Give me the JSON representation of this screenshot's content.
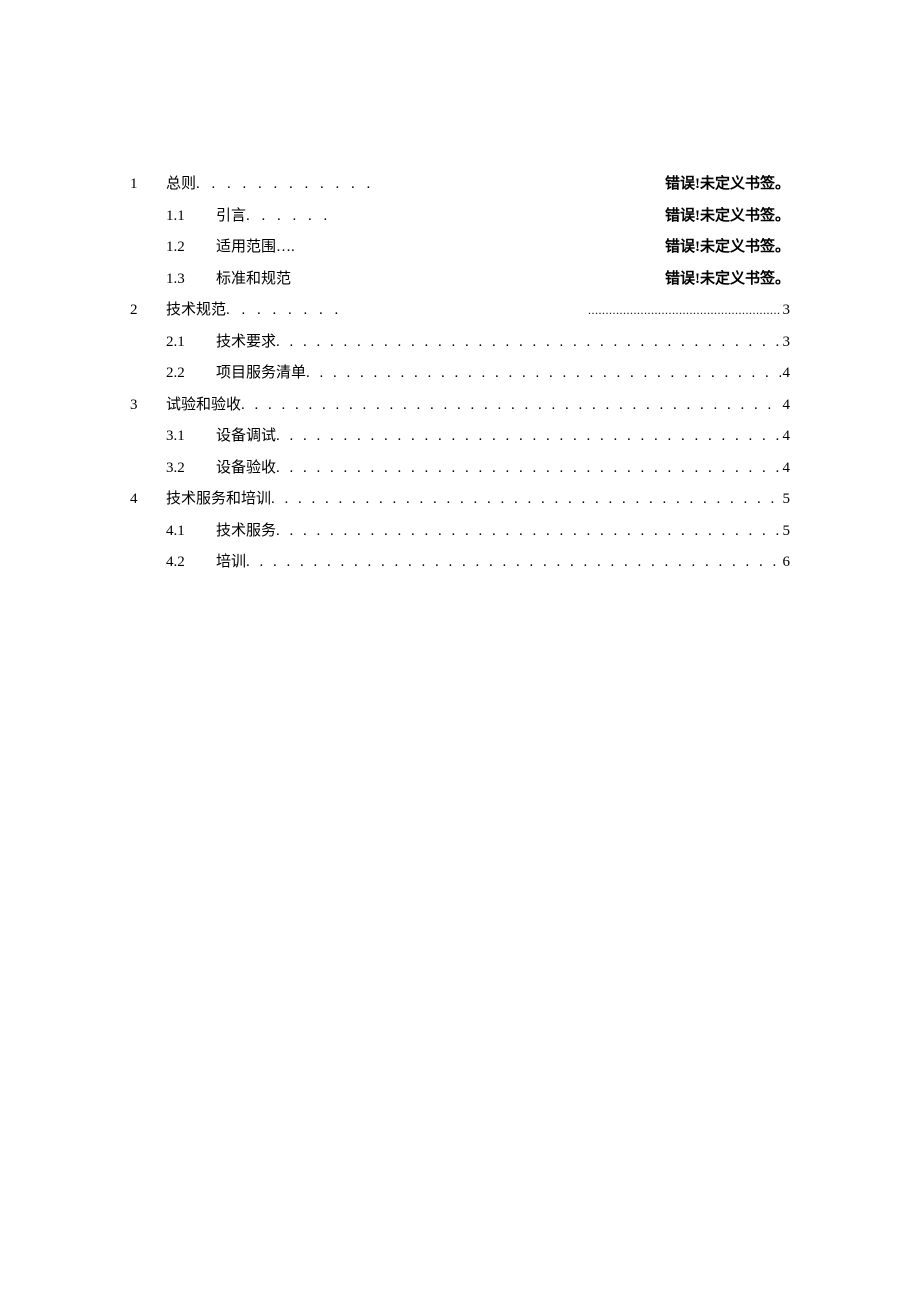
{
  "toc": [
    {
      "level": 1,
      "num": "1",
      "title": "总则",
      "page": "错误!未定义书签。",
      "leader": "short-dots",
      "dots": ". . . . . . . . . . . ."
    },
    {
      "level": 2,
      "num": "1.1",
      "title": "引言",
      "page": "错误!未定义书签。",
      "leader": "short-dots",
      "dots": ". . . . . ."
    },
    {
      "level": 2,
      "num": "1.2",
      "title": "适用范围…",
      "page": "错误!未定义书签。",
      "leader": "short-dots",
      "dots": "."
    },
    {
      "level": 2,
      "num": "1.3",
      "title": "标准和规范",
      "page": "错误!未定义书签。",
      "leader": "short-dots",
      "dots": ""
    },
    {
      "level": 1,
      "num": "2",
      "title": "技术规范",
      "page": "3",
      "leader": "mixed",
      "dots": ". . . . . . . .",
      "fine": "......................................................."
    },
    {
      "level": 2,
      "num": "2.1",
      "title": "技术要求",
      "page": "3",
      "leader": "dots"
    },
    {
      "level": 2,
      "num": "2.2",
      "title": "项目服务清单",
      "page": "4",
      "leader": "dots"
    },
    {
      "level": 1,
      "num": "3",
      "title": "试验和验收",
      "page": "4",
      "leader": "dots"
    },
    {
      "level": 2,
      "num": "3.1",
      "title": "设备调试",
      "page": "4",
      "leader": "dots"
    },
    {
      "level": 2,
      "num": "3.2",
      "title": "设备验收",
      "page": "4",
      "leader": "dots"
    },
    {
      "level": 1,
      "num": "4",
      "title": "技术服务和培训",
      "page": "5",
      "leader": "dots"
    },
    {
      "level": 2,
      "num": "4.1",
      "title": "技术服务",
      "page": "5",
      "leader": "dots"
    },
    {
      "level": 2,
      "num": "4.2",
      "title": "培训",
      "page": "6",
      "leader": "dots"
    }
  ],
  "dot_fill": ". . . . . . . . . . . . . . . . . . . . . . . . . . . . . . . . . . . . . . . . . . . . . . . . . . . . . . . . . . . . . . . . . . . . . . . . . . . . . . . . . . . . . . . . . . . . . . . . . . . . . . . . . . . . . . . . . . . . . . . . . . . . . . . . . . . ."
}
